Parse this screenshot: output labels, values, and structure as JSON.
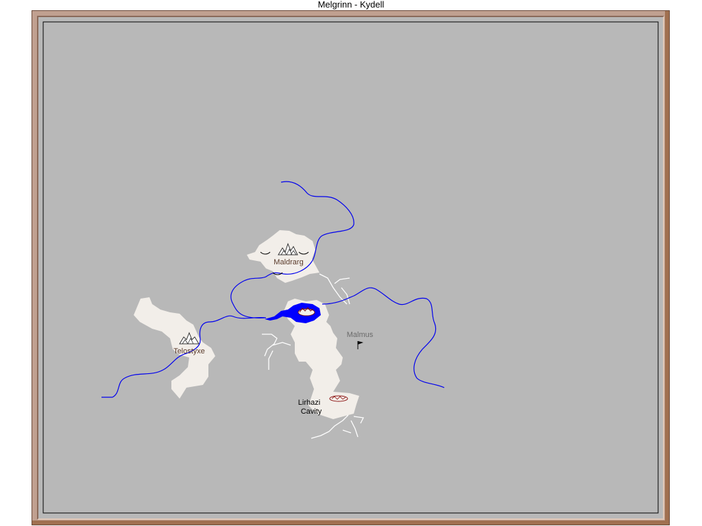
{
  "window": {
    "title": "Melgrinn - Kydell"
  },
  "places": {
    "maldrarg": {
      "label": "Maldrarg",
      "icon": "mountain-town-icon"
    },
    "telostyxe": {
      "label": "Telostyxe",
      "icon": "mountain-town-icon"
    },
    "malmus": {
      "label": "Malmus",
      "icon": "flag-icon"
    },
    "lirhazi_line1": "Lirhazi",
    "lirhazi_line2": "Cavity",
    "lake_town": {
      "icon": "lake-town-icon"
    }
  },
  "colors": {
    "sea": "#b8b8b8",
    "land": "#f2eee9",
    "river": "#0000ee",
    "lake": "#0000ff",
    "road": "#ffffff",
    "frame": "#c0a090",
    "town_label": "#5a3a2a",
    "region_label": "#666666"
  }
}
